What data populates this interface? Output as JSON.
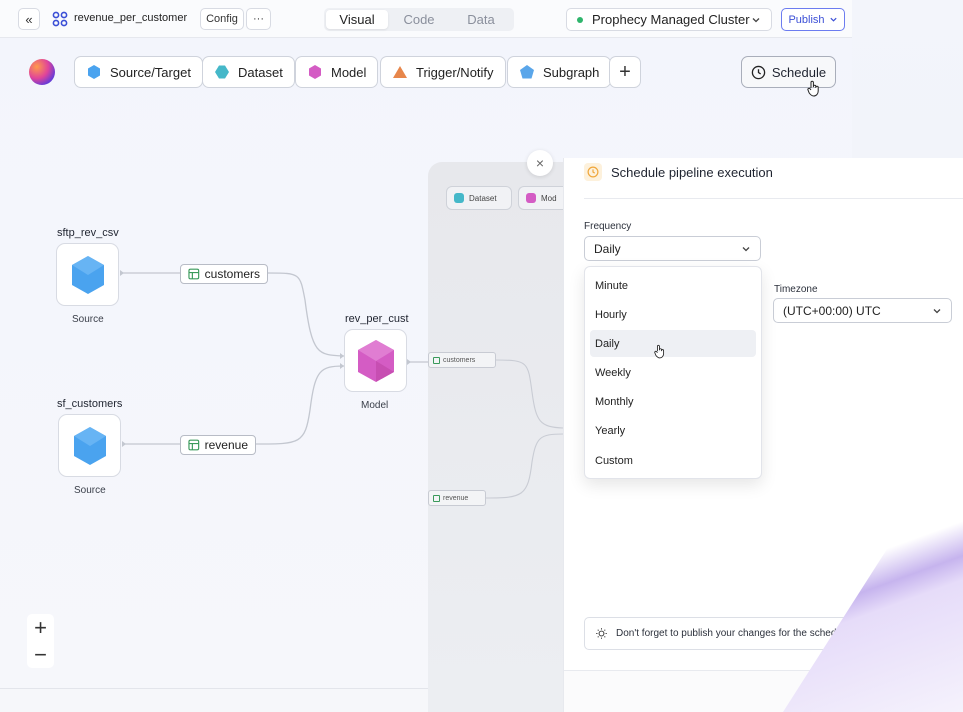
{
  "topbar": {
    "collapse_glyph": "«",
    "pipeline_name": "revenue_per_customer",
    "config_label": "Config",
    "more_label": "···",
    "tabs": [
      "Visual",
      "Code",
      "Data"
    ],
    "active_tab": "Visual",
    "cluster_name": "Prophecy Managed Cluster",
    "publish_label": "Publish"
  },
  "toolbar": {
    "items": [
      {
        "label": "Source/Target",
        "icon": "source-target-icon"
      },
      {
        "label": "Dataset",
        "icon": "dataset-icon"
      },
      {
        "label": "Model",
        "icon": "model-icon"
      },
      {
        "label": "Trigger/Notify",
        "icon": "trigger-notify-icon"
      },
      {
        "label": "Subgraph",
        "icon": "subgraph-icon"
      }
    ],
    "add_label": "+",
    "schedule_label": "Schedule"
  },
  "canvas": {
    "nodes": [
      {
        "name": "sftp_rev_csv",
        "type": "Source"
      },
      {
        "name": "sf_customers",
        "type": "Source"
      },
      {
        "name": "rev_per_cust",
        "type": "Model"
      }
    ],
    "ports": [
      "customers",
      "revenue"
    ],
    "zoom_in": "+",
    "zoom_out": "−"
  },
  "ghost": {
    "dataset_label": "Dataset",
    "model_label": "Mod",
    "customers_label": "customers",
    "revenue_label": "revenue",
    "close_label": "×"
  },
  "schedule_panel": {
    "title": "Schedule pipeline execution",
    "frequency_label": "Frequency",
    "frequency_value": "Daily",
    "options": [
      "Minute",
      "Hourly",
      "Daily",
      "Weekly",
      "Monthly",
      "Yearly",
      "Custom"
    ],
    "selected_option": "Daily",
    "timezone_label": "Timezone",
    "timezone_value": "(UTC+00:00) UTC",
    "tip": "Don't forget to publish your changes for the schedule to"
  },
  "colors": {
    "accent": "#3b4fd6",
    "source_blue": "#4aa3ef",
    "model_pink": "#d45cc4",
    "dataset_teal": "#45b8c9",
    "trigger_orange": "#e7864b",
    "clock_orange": "#f0a73c",
    "cluster_dot": "#2fb56c"
  }
}
